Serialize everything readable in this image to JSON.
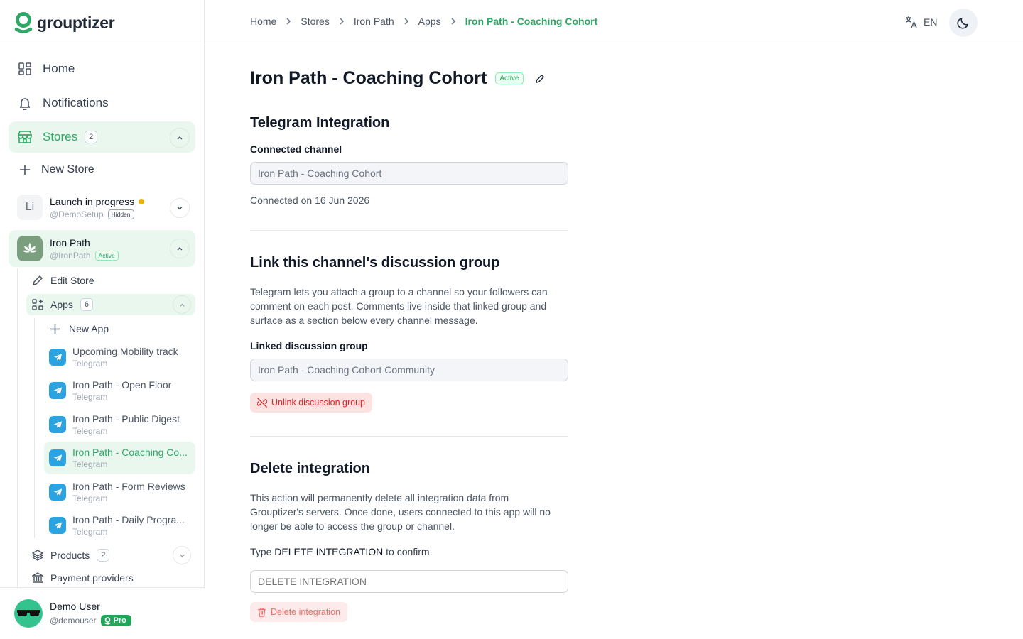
{
  "brand": {
    "name": "grouptizer",
    "accent": "#2fa867"
  },
  "sidebar": {
    "nav": [
      {
        "label": "Home",
        "icon": "dashboard-icon"
      },
      {
        "label": "Notifications",
        "icon": "bell-icon"
      },
      {
        "label": "Stores",
        "icon": "store-icon",
        "count": "2"
      }
    ],
    "new_store": "New Store",
    "stores": [
      {
        "initials": "Li",
        "name": "Launch in progress",
        "handle": "@DemoSetup",
        "badge": "Hidden"
      },
      {
        "name": "Iron Path",
        "handle": "@IronPath",
        "badge": "Active"
      }
    ],
    "store_menu": {
      "edit_store": "Edit Store",
      "apps": "Apps",
      "apps_count": "6",
      "new_app": "New App",
      "products": "Products",
      "products_count": "2",
      "payment_providers": "Payment providers"
    },
    "apps": [
      {
        "name": "Upcoming Mobility track",
        "type": "Telegram"
      },
      {
        "name": "Iron Path - Open Floor",
        "type": "Telegram"
      },
      {
        "name": "Iron Path - Public Digest",
        "type": "Telegram"
      },
      {
        "name": "Iron Path - Coaching Co...",
        "type": "Telegram"
      },
      {
        "name": "Iron Path - Form Reviews",
        "type": "Telegram"
      },
      {
        "name": "Iron Path - Daily Progra...",
        "type": "Telegram"
      }
    ],
    "user": {
      "name": "Demo User",
      "handle": "@demouser",
      "plan": "Pro"
    }
  },
  "header": {
    "breadcrumb": [
      "Home",
      "Stores",
      "Iron Path",
      "Apps",
      "Iron Path - Coaching Cohort"
    ],
    "language": "EN"
  },
  "main": {
    "title": "Iron Path - Coaching Cohort",
    "status": "Active",
    "telegram": {
      "title": "Telegram Integration",
      "channel_label": "Connected channel",
      "channel_value": "Iron Path - Coaching Cohort",
      "connected_on": "Connected on 16 Jun 2026"
    },
    "discussion": {
      "title": "Link this channel's discussion group",
      "desc1": "Telegram lets you attach a group to a channel so your followers can",
      "desc2": "comment on each post. Comments live inside that linked group and",
      "desc3": "surface as a section below every channel message.",
      "group_label": "Linked discussion group",
      "group_value": "Iron Path - Coaching Cohort Community",
      "unlink_button": "Unlink discussion group"
    },
    "delete": {
      "title": "Delete integration",
      "desc1": "This action will permanently delete all integration data from",
      "desc2": "Grouptizer's servers. Once done, users connected to this app will no",
      "desc3": "longer be able to access the group or channel.",
      "confirm_prefix": "Type ",
      "confirm_phrase": "DELETE INTEGRATION",
      "confirm_suffix": " to confirm.",
      "confirm_placeholder": "DELETE INTEGRATION",
      "delete_button": "Delete integration"
    }
  }
}
